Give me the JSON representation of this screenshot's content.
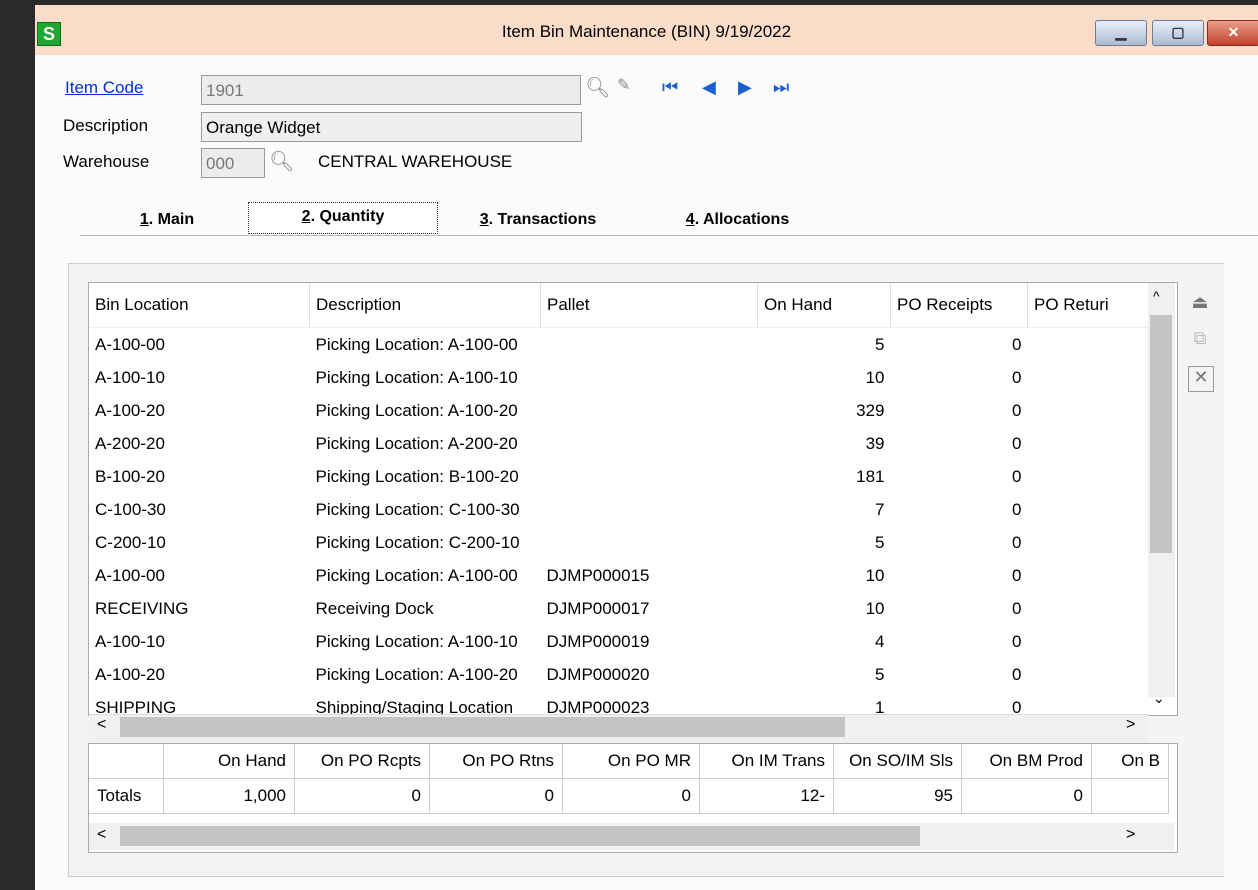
{
  "window": {
    "title": "Item Bin Maintenance (BIN) 9/19/2022",
    "app_icon_letter": "S"
  },
  "form": {
    "item_code_label": "Item Code",
    "item_code_value": "1901",
    "description_label": "Description",
    "description_value": "Orange Widget",
    "warehouse_label": "Warehouse",
    "warehouse_code": "000",
    "warehouse_name": "CENTRAL WAREHOUSE"
  },
  "tabs": [
    {
      "num": "1",
      "label": ". Main"
    },
    {
      "num": "2",
      "label": ". Quantity"
    },
    {
      "num": "3",
      "label": ". Transactions"
    },
    {
      "num": "4",
      "label": ". Allocations"
    }
  ],
  "grid": {
    "columns": [
      "Bin Location",
      "Description",
      "Pallet",
      "On Hand",
      "PO Receipts",
      "PO Returi"
    ],
    "rows": [
      [
        "A-100-00",
        "Picking Location: A-100-00",
        "",
        "5",
        "0"
      ],
      [
        "A-100-10",
        "Picking Location: A-100-10",
        "",
        "10",
        "0"
      ],
      [
        "A-100-20",
        "Picking Location: A-100-20",
        "",
        "329",
        "0"
      ],
      [
        "A-200-20",
        "Picking Location: A-200-20",
        "",
        "39",
        "0"
      ],
      [
        "B-100-20",
        "Picking Location: B-100-20",
        "",
        "181",
        "0"
      ],
      [
        "C-100-30",
        "Picking Location: C-100-30",
        "",
        "7",
        "0"
      ],
      [
        "C-200-10",
        "Picking Location: C-200-10",
        "",
        "5",
        "0"
      ],
      [
        "A-100-00",
        "Picking Location: A-100-00",
        "DJMP000015",
        "10",
        "0"
      ],
      [
        "RECEIVING",
        "Receiving Dock",
        "DJMP000017",
        "10",
        "0"
      ],
      [
        "A-100-10",
        "Picking Location: A-100-10",
        "DJMP000019",
        "4",
        "0"
      ],
      [
        "A-100-20",
        "Picking Location: A-100-20",
        "DJMP000020",
        "5",
        "0"
      ],
      [
        "SHIPPING",
        "Shipping/Staging Location",
        "DJMP000023",
        "1",
        "0"
      ]
    ]
  },
  "totals": {
    "headers": [
      "",
      "On Hand",
      "On PO Rcpts",
      "On PO Rtns",
      "On PO MR",
      "On IM Trans",
      "On SO/IM Sls",
      "On BM Prod",
      "On B"
    ],
    "row": [
      "Totals",
      "1,000",
      "0",
      "0",
      "0",
      "12-",
      "95",
      "0",
      ""
    ]
  }
}
